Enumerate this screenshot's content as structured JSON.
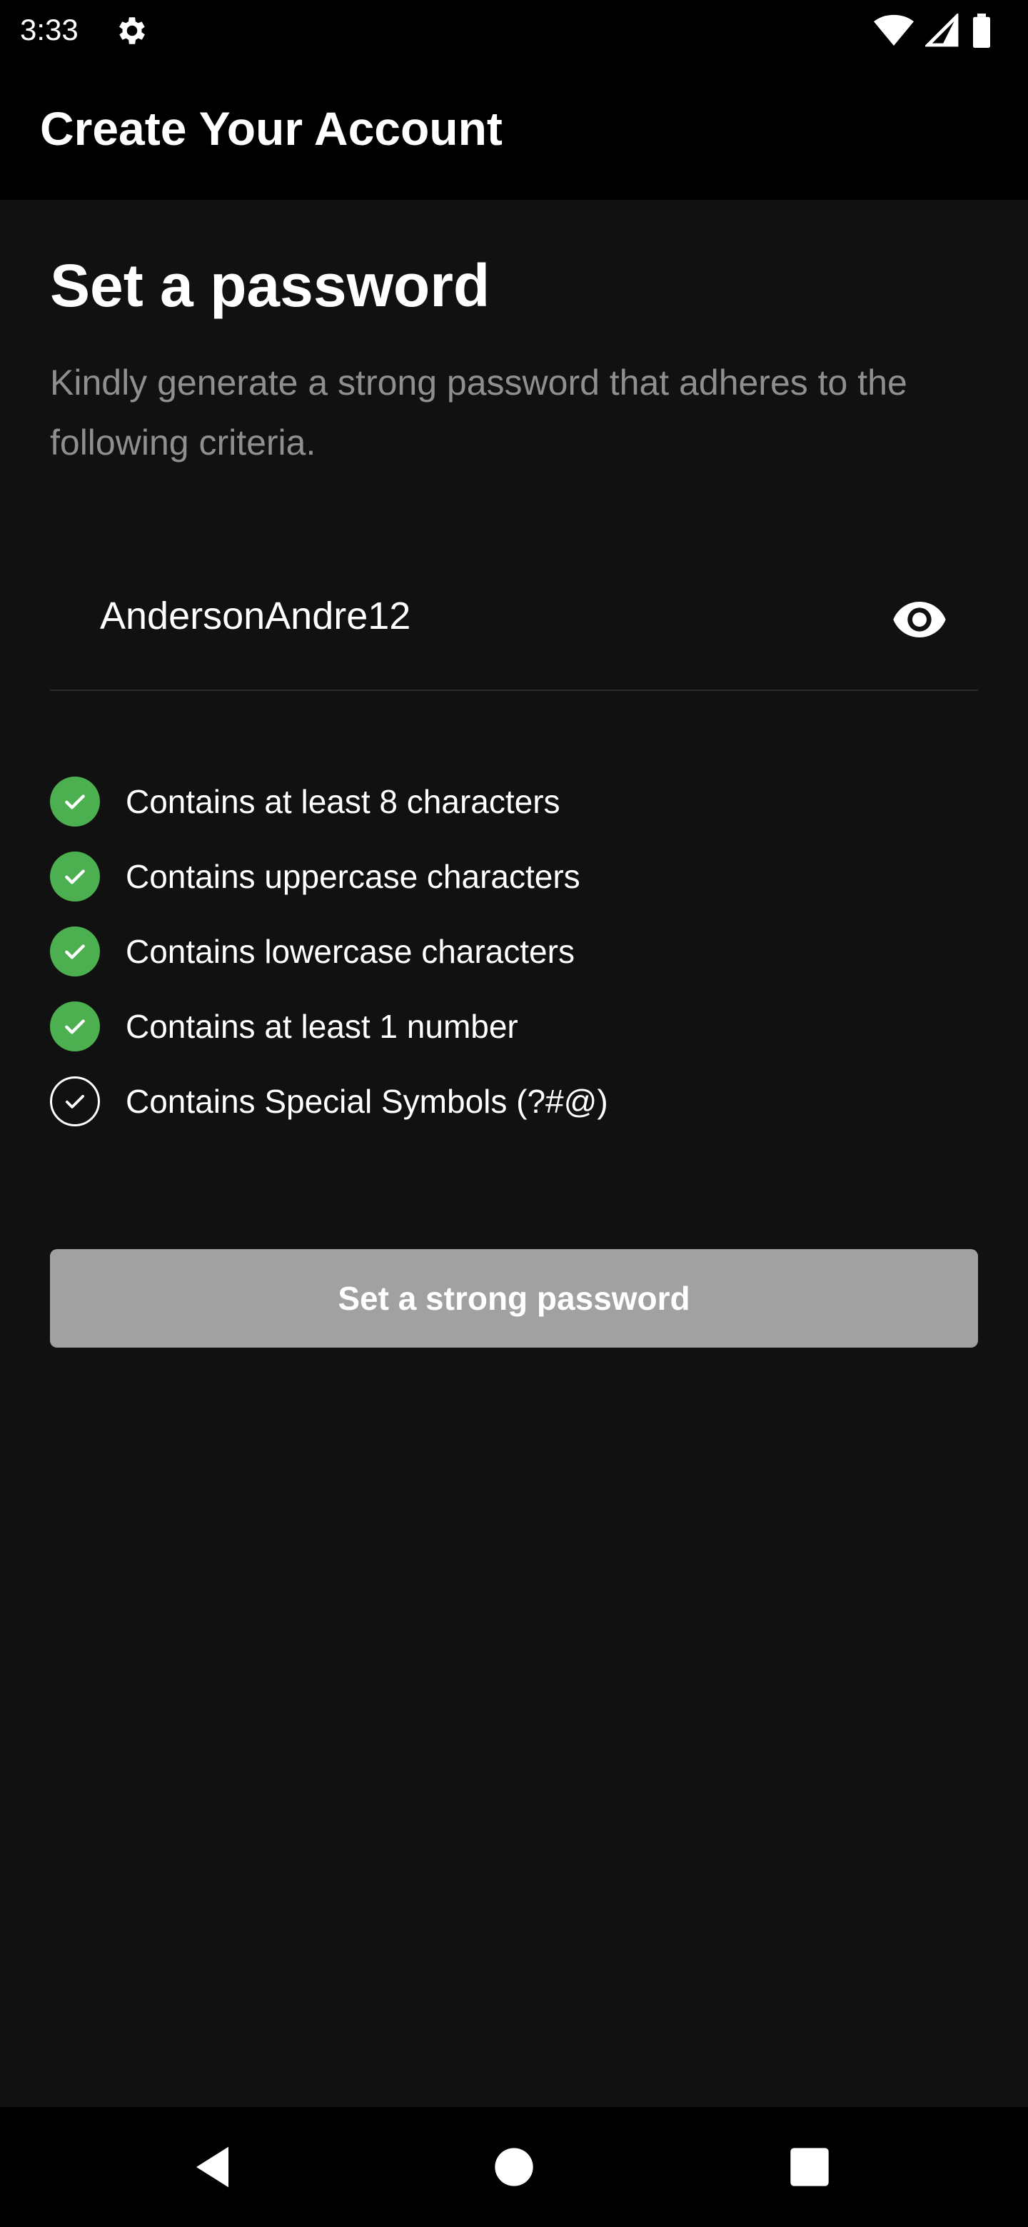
{
  "status_bar": {
    "time": "3:33",
    "icons": [
      "settings-gear-icon",
      "wifi-icon",
      "cellular-signal-icon",
      "battery-icon"
    ]
  },
  "app_bar": {
    "title": "Create Your Account"
  },
  "main": {
    "heading": "Set a password",
    "subtitle": "Kindly generate a strong password that adheres to the following criteria.",
    "password_field": {
      "value": "AndersonAndre12",
      "toggle_icon": "eye-icon"
    },
    "criteria": [
      {
        "label": "Contains at least 8 characters",
        "met": true
      },
      {
        "label": "Contains uppercase characters",
        "met": true
      },
      {
        "label": "Contains lowercase characters",
        "met": true
      },
      {
        "label": "Contains at least 1 number",
        "met": true
      },
      {
        "label": "Contains Special Symbols (?#@)",
        "met": false
      }
    ],
    "submit_button": {
      "label": "Set a strong password",
      "enabled": false
    }
  },
  "nav_bar": {
    "icons": [
      "back-triangle-icon",
      "home-circle-icon",
      "recents-square-icon"
    ]
  },
  "colors": {
    "background": "#111111",
    "bar_background": "#000000",
    "check_met": "#4caf50",
    "button_disabled": "#a1a1a1",
    "subtitle_text": "#8f8f8f"
  }
}
